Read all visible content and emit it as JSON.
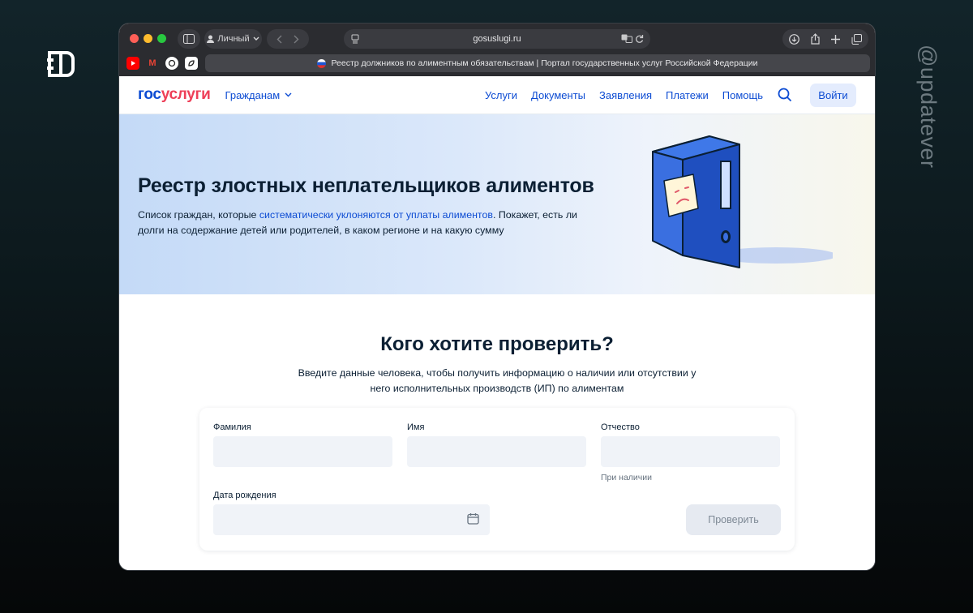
{
  "browser": {
    "profile_label": "Личный",
    "url": "gosuslugi.ru",
    "tab_title": "Реестр должников по алиментным обязательствам | Портал государственных услуг Российской Федерации"
  },
  "header": {
    "brand_part1": "гос",
    "brand_part2": "услуги",
    "citizens_label": "Гражданам",
    "nav": [
      "Услуги",
      "Документы",
      "Заявления",
      "Платежи",
      "Помощь"
    ],
    "login_label": "Войти"
  },
  "hero": {
    "title": "Реестр злостных неплательщиков алиментов",
    "desc_before": "Список граждан, которые ",
    "desc_link": "систематически уклоняются от уплаты алиментов",
    "desc_after": ". Покажет, есть ли долги на содержание детей или родителей, в каком регионе и на какую сумму"
  },
  "check": {
    "title": "Кого хотите проверить?",
    "subtitle": "Введите данные человека, чтобы получить информацию о наличии или отсутствии у него исполнительных производств (ИП) по алиментам",
    "surname_label": "Фамилия",
    "name_label": "Имя",
    "patronymic_label": "Отчество",
    "patronymic_hint": "При наличии",
    "birthdate_label": "Дата рождения",
    "submit_label": "Проверить"
  },
  "watermark": "@updatever",
  "colors": {
    "brand_blue": "#0d4cd3",
    "brand_red": "#ee3f58",
    "toolbar_bg": "#2b2c30"
  },
  "icons": [
    "sidebar-icon",
    "person-icon",
    "chevron-down-icon",
    "back-icon",
    "forward-icon",
    "page-icon",
    "translate-icon",
    "reload-icon",
    "download-icon",
    "share-icon",
    "new-tab-icon",
    "tabs-icon",
    "search-icon",
    "calendar-icon",
    "flag-icon"
  ]
}
